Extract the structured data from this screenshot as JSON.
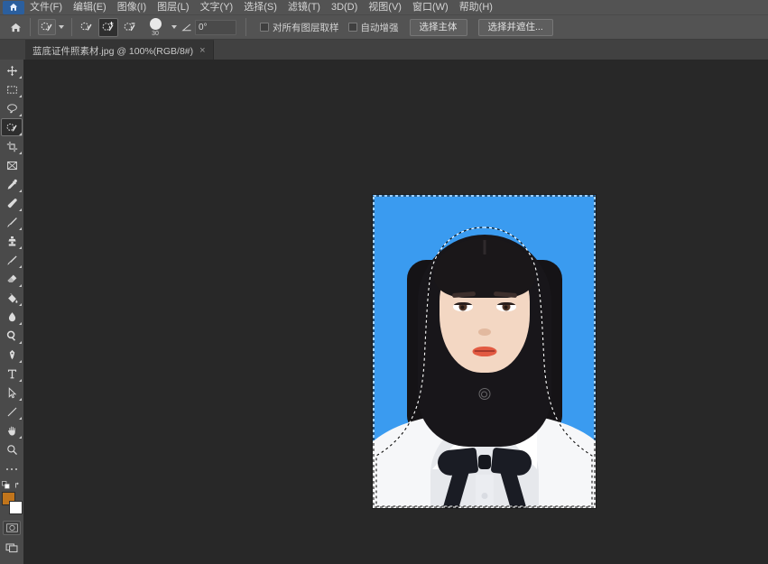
{
  "app": {
    "name": "Adobe Photoshop",
    "locale": "zh-CN",
    "theme_colors": {
      "menu_bar": "#535353",
      "options_bar": "#535353",
      "tab_bar": "#414141",
      "toolbar": "#4a4a4a",
      "canvas_bg": "#282828",
      "active_tool_bg": "#2e2e2e",
      "photo_background_blue": "#3a9bf0",
      "foreground_color": "#c1751c",
      "background_color": "#ffffff"
    }
  },
  "menubar": {
    "home_icon": "home-icon",
    "items": [
      {
        "label": "文件(F)",
        "name": "menu-file"
      },
      {
        "label": "编辑(E)",
        "name": "menu-edit"
      },
      {
        "label": "图像(I)",
        "name": "menu-image"
      },
      {
        "label": "图层(L)",
        "name": "menu-layer"
      },
      {
        "label": "文字(Y)",
        "name": "menu-type"
      },
      {
        "label": "选择(S)",
        "name": "menu-select"
      },
      {
        "label": "滤镜(T)",
        "name": "menu-filter"
      },
      {
        "label": "3D(D)",
        "name": "menu-3d"
      },
      {
        "label": "视图(V)",
        "name": "menu-view"
      },
      {
        "label": "窗口(W)",
        "name": "menu-window"
      },
      {
        "label": "帮助(H)",
        "name": "menu-help"
      }
    ]
  },
  "options_bar": {
    "tool_preset_label": "quick-selection-tool-preset",
    "selection_modes": [
      {
        "name": "new-selection",
        "label": "新选区",
        "active": false
      },
      {
        "name": "add-to-selection",
        "label": "添加到选区",
        "active": true
      },
      {
        "name": "subtract-from-selection",
        "label": "从选区减去",
        "active": false
      }
    ],
    "brush_size": "30",
    "brush_picker_label": "画笔选项",
    "angle_value": "0°",
    "angle_icon": "angle-icon",
    "checkboxes": [
      {
        "label": "对所有图层取样",
        "name": "sample-all-layers-checkbox",
        "checked": false
      },
      {
        "label": "自动增强",
        "name": "auto-enhance-checkbox",
        "checked": false
      }
    ],
    "buttons": [
      {
        "label": "选择主体",
        "name": "select-subject-button"
      },
      {
        "label": "选择并遮住...",
        "name": "select-and-mask-button"
      }
    ]
  },
  "tabbar": {
    "document": {
      "title": "蓝底证件照素材.jpg @ 100%(RGB/8#)",
      "filename": "蓝底证件照素材.jpg",
      "zoom": "100%",
      "color_mode": "RGB/8#",
      "close_glyph": "×"
    }
  },
  "toolbar": {
    "tools": [
      {
        "name": "move-tool",
        "label": "移动工具",
        "icon": "move-icon",
        "active": false,
        "has_flyout": true
      },
      {
        "name": "marquee-tool",
        "label": "矩形选框工具",
        "icon": "marquee-icon",
        "active": false,
        "has_flyout": true
      },
      {
        "name": "lasso-tool",
        "label": "套索工具",
        "icon": "lasso-icon",
        "active": false,
        "has_flyout": true
      },
      {
        "name": "quick-selection-tool",
        "label": "快速选择工具",
        "icon": "quick-selection-icon",
        "active": true,
        "has_flyout": true
      },
      {
        "name": "crop-tool",
        "label": "裁剪工具",
        "icon": "crop-icon",
        "active": false,
        "has_flyout": true
      },
      {
        "name": "frame-tool",
        "label": "画框工具",
        "icon": "frame-icon",
        "active": false,
        "has_flyout": false
      },
      {
        "name": "eyedropper-tool",
        "label": "吸管工具",
        "icon": "eyedropper-icon",
        "active": false,
        "has_flyout": true
      },
      {
        "name": "healing-brush-tool",
        "label": "污点修复画笔工具",
        "icon": "healing-brush-icon",
        "active": false,
        "has_flyout": true
      },
      {
        "name": "brush-tool",
        "label": "画笔工具",
        "icon": "brush-icon",
        "active": false,
        "has_flyout": true
      },
      {
        "name": "clone-stamp-tool",
        "label": "仿制图章工具",
        "icon": "clone-stamp-icon",
        "active": false,
        "has_flyout": true
      },
      {
        "name": "history-brush-tool",
        "label": "历史记录画笔工具",
        "icon": "history-brush-icon",
        "active": false,
        "has_flyout": true
      },
      {
        "name": "eraser-tool",
        "label": "橡皮擦工具",
        "icon": "eraser-icon",
        "active": false,
        "has_flyout": true
      },
      {
        "name": "gradient-tool",
        "label": "渐变工具",
        "icon": "paint-bucket-icon",
        "active": false,
        "has_flyout": true
      },
      {
        "name": "blur-tool",
        "label": "模糊工具",
        "icon": "blur-drop-icon",
        "active": false,
        "has_flyout": true
      },
      {
        "name": "dodge-tool",
        "label": "减淡工具",
        "icon": "dodge-icon",
        "active": false,
        "has_flyout": true
      },
      {
        "name": "pen-tool",
        "label": "钢笔工具",
        "icon": "pen-icon",
        "active": false,
        "has_flyout": true
      },
      {
        "name": "type-tool",
        "label": "横排文字工具",
        "icon": "type-t-icon",
        "active": false,
        "has_flyout": true
      },
      {
        "name": "path-selection-tool",
        "label": "路径选择工具",
        "icon": "path-arrow-icon",
        "active": false,
        "has_flyout": true
      },
      {
        "name": "shape-tool",
        "label": "矩形工具",
        "icon": "line-shape-icon",
        "active": false,
        "has_flyout": true
      },
      {
        "name": "hand-tool",
        "label": "抓手工具",
        "icon": "hand-icon",
        "active": false,
        "has_flyout": true
      },
      {
        "name": "zoom-tool",
        "label": "缩放工具",
        "icon": "magnifier-icon",
        "active": false,
        "has_flyout": false
      }
    ],
    "more_tools": {
      "name": "edit-toolbar-button",
      "label": "...",
      "icon": "ellipsis-icon"
    },
    "color_swatches": {
      "foreground": {
        "name": "foreground-color-swatch",
        "color": "#c1751c"
      },
      "background": {
        "name": "background-color-swatch",
        "color": "#ffffff"
      },
      "swap_icon": "swap-colors-icon",
      "default_icon": "default-colors-icon"
    },
    "quick_mask": {
      "name": "quick-mask-button",
      "icon": "quick-mask-icon"
    },
    "screen_mode": {
      "name": "screen-mode-button",
      "icon": "screen-mode-icon"
    }
  },
  "canvas": {
    "document_name": "蓝底证件照素材.jpg",
    "zoom_level": "100%",
    "image": {
      "description": "蓝底证件照 — 女性人像",
      "background_color": "#3a9bf0",
      "shirt_color": "#ffffff",
      "bow_color": "#1a1c24",
      "selection_active": true,
      "selection_type": "marching-ants-subject-selection"
    }
  }
}
